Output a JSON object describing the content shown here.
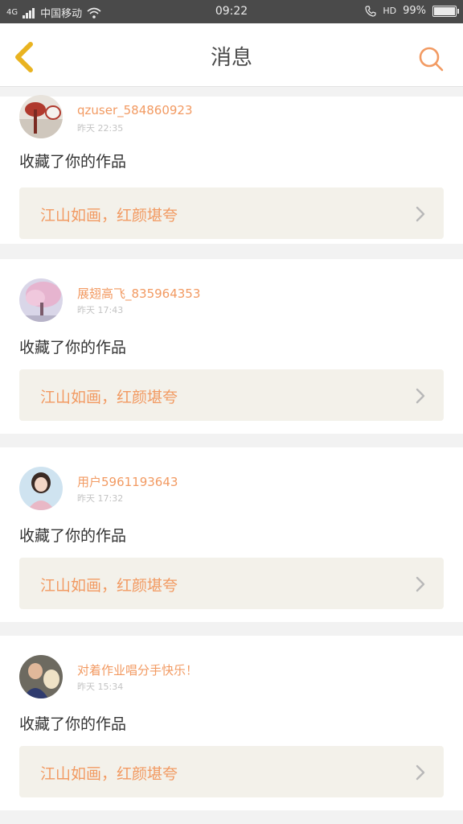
{
  "status_bar": {
    "network": "4G",
    "carrier": "中国移动",
    "time": "09:22",
    "hd": "HD",
    "battery": "99%",
    "battery_level": 0.99
  },
  "header": {
    "title": "消息",
    "back_icon": "chevron-left-icon",
    "search_icon": "search-icon",
    "accent": "#f29a62",
    "back_color": "#e9b320"
  },
  "messages": [
    {
      "username": "qzuser_584860923",
      "time": "昨天 22:35",
      "action": "收藏了你的作品",
      "work_title": "江山如画，红颜堪夸"
    },
    {
      "username": "展翅高飞_835964353",
      "time": "昨天 17:43",
      "action": "收藏了你的作品",
      "work_title": "江山如画，红颜堪夸"
    },
    {
      "username": "用户5961193643",
      "time": "昨天 17:32",
      "action": "收藏了你的作品",
      "work_title": "江山如画，红颜堪夸"
    },
    {
      "username": "对着作业唱分手快乐！",
      "time": "昨天 15:34",
      "action": "收藏了你的作品",
      "work_title": "江山如画，红颜堪夸"
    }
  ]
}
